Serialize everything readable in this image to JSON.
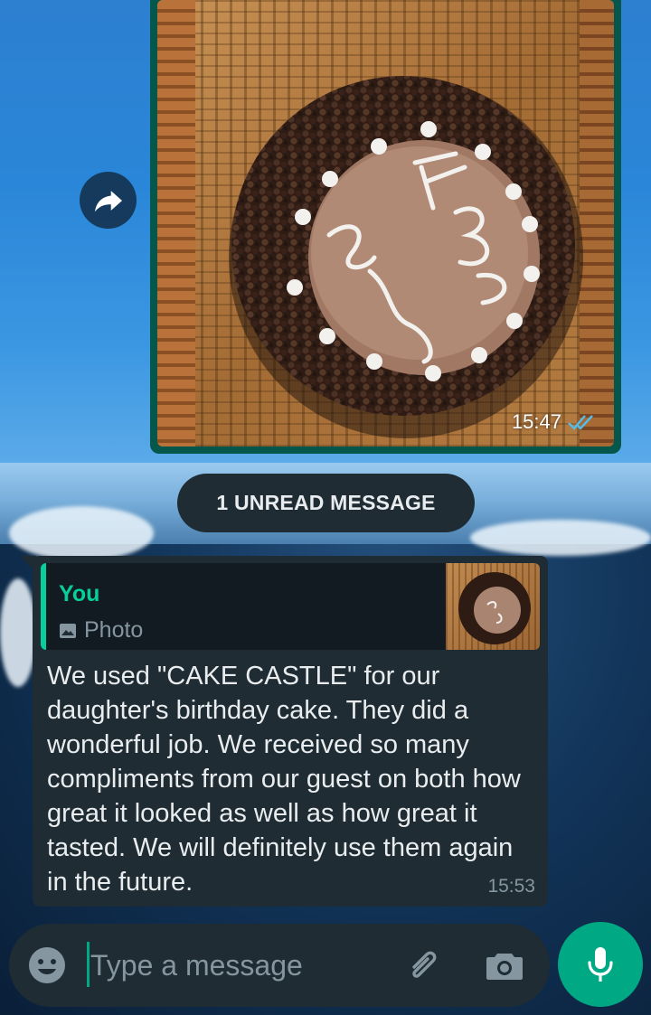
{
  "colors": {
    "accent": "#00a884",
    "bubble_dark": "#1f2c33",
    "sent_bubble": "#05564b",
    "quote_author": "#06cf9c",
    "read_ticks": "#53bdeb"
  },
  "sent_image_message": {
    "time": "15:47",
    "status_icon": "double-check-read-icon"
  },
  "forward_button": {
    "icon": "forward-icon"
  },
  "unread_divider": {
    "label": "1 UNREAD MESSAGE"
  },
  "received_message": {
    "quote": {
      "author": "You",
      "type_icon": "image-icon",
      "type_label": "Photo"
    },
    "text": "We used \"CAKE CASTLE\" for our daughter's birthday cake. They did a wonderful job. We received so many compliments from our guest on both how great it looked as well as how great it tasted. We will definitely use them again in the future.",
    "time": "15:53"
  },
  "composer": {
    "placeholder": "Type a message",
    "value": "",
    "emoji_icon": "emoji-icon",
    "attach_icon": "paperclip-icon",
    "camera_icon": "camera-icon",
    "mic_icon": "microphone-icon"
  }
}
